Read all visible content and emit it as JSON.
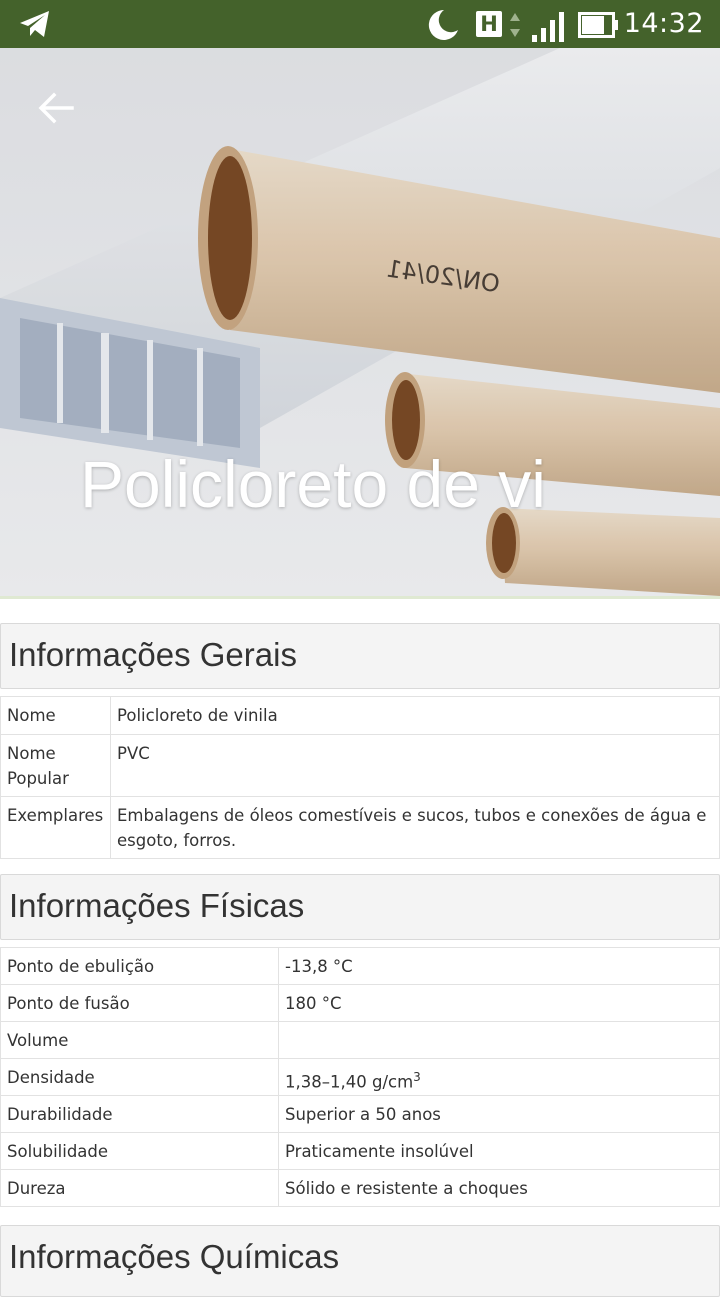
{
  "status_bar": {
    "time": "14:32",
    "network_badge": "H",
    "icons": [
      "telegram-icon",
      "moon-icon",
      "network-arrows-icon",
      "signal-icon",
      "battery-icon"
    ],
    "background": "#44622b"
  },
  "hero": {
    "title": "Policloreto de vi",
    "back_icon": "arrow-left-icon"
  },
  "general": {
    "heading": "Informações Gerais",
    "rows": [
      {
        "key": "Nome",
        "value": "Policloreto de vinila"
      },
      {
        "key": "Nome Popular",
        "value": "PVC"
      },
      {
        "key": "Exemplares",
        "value": "Embalagens de óleos comestíveis e sucos, tubos e conexões de água e esgoto, forros."
      }
    ]
  },
  "physical": {
    "heading": "Informações Físicas",
    "rows": [
      {
        "key": "Ponto de ebulição",
        "value": "-13,8 °C"
      },
      {
        "key": "Ponto de fusão",
        "value": "180 °C"
      },
      {
        "key": "Volume",
        "value": ""
      },
      {
        "key": "Densidade",
        "value": "1,38–1,40 g/cm",
        "sup": "3"
      },
      {
        "key": "Durabilidade",
        "value": "Superior a 50 anos"
      },
      {
        "key": "Solubilidade",
        "value": "Praticamente insolúvel"
      },
      {
        "key": "Dureza",
        "value": "Sólido e resistente a choques"
      }
    ]
  },
  "chemical": {
    "heading": "Informações Químicas"
  }
}
